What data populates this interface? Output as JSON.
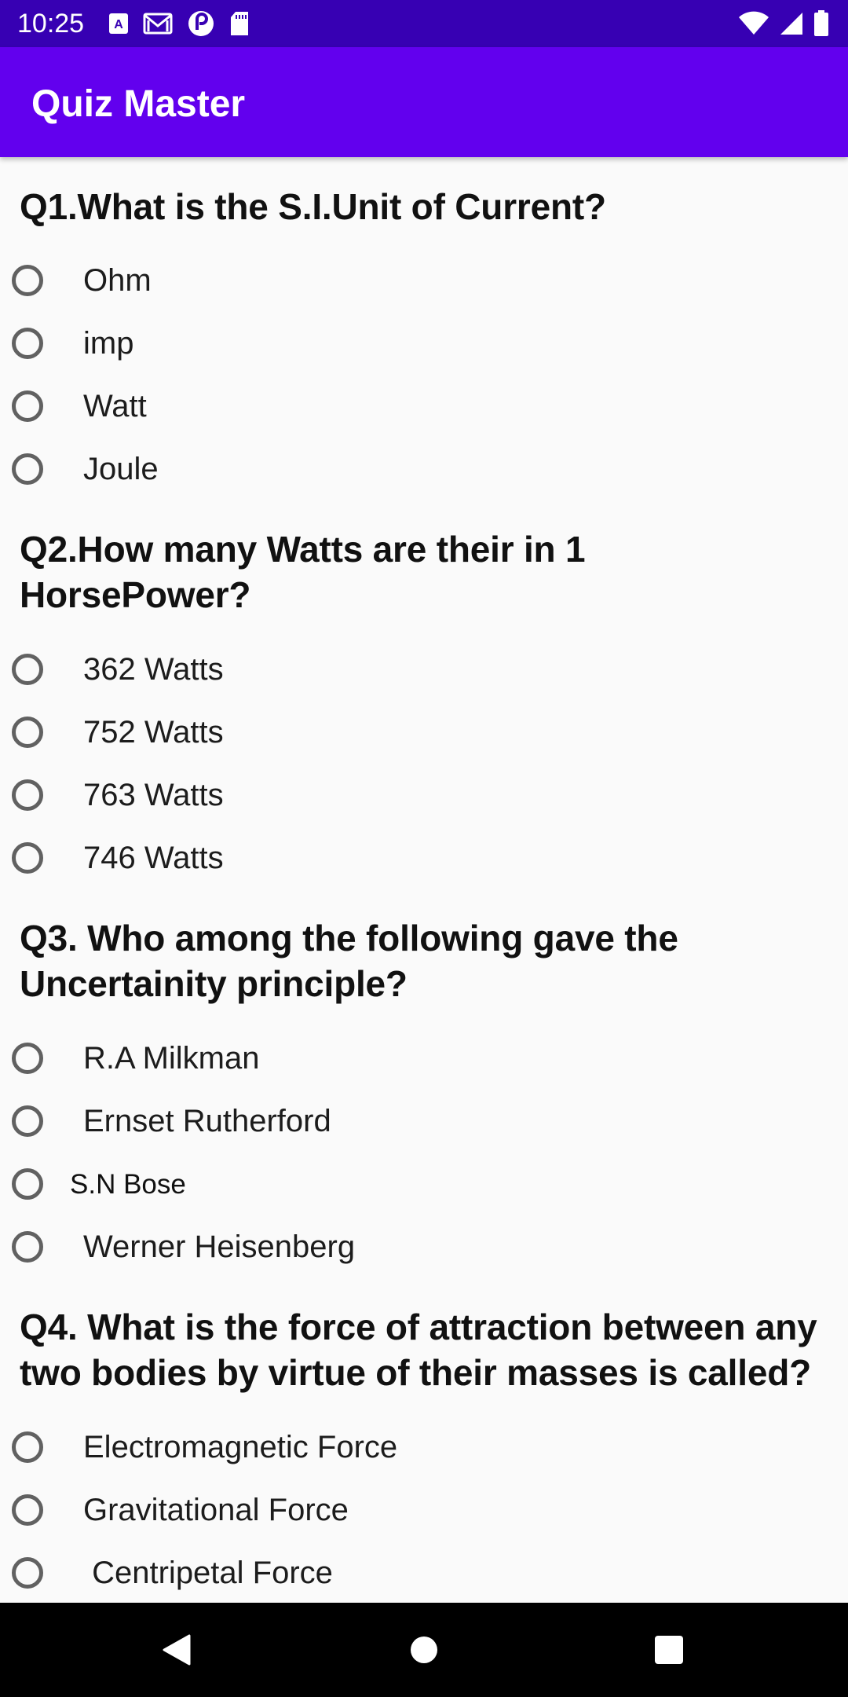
{
  "status_bar": {
    "time": "10:25",
    "left_icons": [
      "app-a-icon",
      "gmail-icon",
      "pocket-casts-icon",
      "sd-card-icon"
    ],
    "right_icons": [
      "wifi-icon",
      "signal-icon",
      "battery-icon"
    ]
  },
  "app_bar": {
    "title": "Quiz Master",
    "color": "#6200ee",
    "status_color": "#3700b3"
  },
  "questions": [
    {
      "text": "Q1.What is the S.I.Unit of Current?",
      "options": [
        "Ohm",
        "imp",
        "Watt",
        "Joule"
      ]
    },
    {
      "text": "Q2.How many Watts are their in 1\nHorsePower?",
      "options": [
        "362 Watts",
        "752 Watts",
        "763 Watts",
        "746 Watts"
      ]
    },
    {
      "text": "Q3. Who among the following gave the\nUncertainity principle?",
      "options": [
        "R.A Milkman",
        "Ernset Rutherford",
        "S.N Bose",
        "Werner Heisenberg"
      ]
    },
    {
      "text": "Q4. What is the force of attraction between any\ntwo bodies by virtue of their masses is called?",
      "options": [
        "Electromagnetic Force",
        "Gravitational Force",
        " Centripetal Force"
      ]
    }
  ],
  "nav_bar": {
    "buttons": [
      "back-icon",
      "home-icon",
      "recents-icon"
    ]
  }
}
